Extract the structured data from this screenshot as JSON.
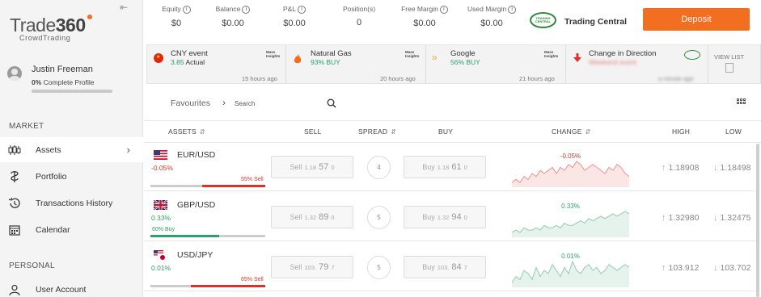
{
  "sidebar": {
    "logo_main": "Trade",
    "logo_num": "360",
    "logo_sub": "CrowdTrading",
    "collapse_icon": "collapse-left-icon",
    "user_name": "Justin Freeman",
    "profile_pct": "0%",
    "profile_text": "Complete Profile",
    "sections": {
      "market": "MARKET",
      "personal": "PERSONAL"
    },
    "items": [
      {
        "label": "Assets",
        "icon": "candlestick-icon"
      },
      {
        "label": "Portfolio",
        "icon": "portfolio-icon"
      },
      {
        "label": "Transactions History",
        "icon": "history-icon"
      },
      {
        "label": "Calendar",
        "icon": "calendar-icon"
      },
      {
        "label": "User Account",
        "icon": "user-icon"
      }
    ]
  },
  "stats": [
    {
      "label": "Equity",
      "value": "$0"
    },
    {
      "label": "Balance",
      "value": "$0.00"
    },
    {
      "label": "P&L",
      "value": "$0.00"
    },
    {
      "label": "Position(s)",
      "value": "0"
    },
    {
      "label": "Free Margin",
      "value": "$0.00"
    },
    {
      "label": "Used Margin",
      "value": "$0.00"
    }
  ],
  "trading_central": "Trading Central",
  "tc_logo_text": "TRADING CENTRAL",
  "deposit_label": "Deposit",
  "news": [
    {
      "title": "CNY event",
      "sub_num": "3.85",
      "sub_text": "Actual",
      "time": "15 hours ago",
      "badge": "Mass Insights"
    },
    {
      "title": "Natural Gas",
      "sub": "93% BUY",
      "time": "20 hours ago",
      "badge": "Mass Insights"
    },
    {
      "title": "Google",
      "sub": "56% BUY",
      "time": "21 hours ago",
      "badge": "Mass Insights"
    },
    {
      "title": "Change in Direction",
      "sub": "Weekend event",
      "time": "a minute ago"
    }
  ],
  "view_list": "VIEW LIST",
  "favourites_label": "Favourites",
  "search_placeholder": "Search",
  "columns": {
    "assets": "ASSETS",
    "sell": "SELL",
    "spread": "SPREAD",
    "buy": "BUY",
    "change": "CHANGE",
    "high": "HIGH",
    "low": "LOW"
  },
  "assets": [
    {
      "name": "EUR/USD",
      "change": "-0.05%",
      "sentiment": "55% Sell",
      "sentiment_side": "sell",
      "sentiment_pct": 55,
      "sell_label": "Sell",
      "sell_small": "1.18",
      "sell_big": "57",
      "sell_tail": "0",
      "spread": "4",
      "buy_label": "Buy",
      "buy_small": "1.18",
      "buy_big": "61",
      "buy_tail": "0",
      "spark_label": "-0.05%",
      "trend": "neg",
      "high": "1.18908",
      "low": "1.18498",
      "spark": [
        3,
        4,
        3,
        5,
        4,
        6,
        5,
        7,
        6,
        7,
        8,
        6,
        8,
        7,
        9,
        8,
        10,
        9,
        7,
        8,
        9,
        8,
        7,
        6,
        8,
        7,
        9,
        8,
        6,
        5
      ]
    },
    {
      "name": "GBP/USD",
      "change": "0.33%",
      "sentiment": "60% Buy",
      "sentiment_side": "buy",
      "sentiment_pct": 60,
      "sell_label": "Sell",
      "sell_small": "1.32",
      "sell_big": "89",
      "sell_tail": "0",
      "spread": "5",
      "buy_label": "Buy",
      "buy_small": "1.32",
      "buy_big": "94",
      "buy_tail": "0",
      "spark_label": "0.33%",
      "trend": "pos",
      "high": "1.32980",
      "low": "1.32475",
      "spark": [
        2,
        3,
        2,
        4,
        3,
        3,
        4,
        3,
        5,
        4,
        4,
        5,
        4,
        6,
        5,
        5,
        6,
        7,
        6,
        8,
        7,
        8,
        9,
        8,
        9,
        10,
        9,
        10,
        11,
        10
      ]
    },
    {
      "name": "USD/JPY",
      "change": "0.01%",
      "sentiment": "65% Sell",
      "sentiment_side": "sell",
      "sentiment_pct": 65,
      "sell_label": "Sell",
      "sell_small": "103.",
      "sell_big": "79",
      "sell_tail": "7",
      "spread": "5",
      "buy_label": "Buy",
      "buy_small": "103.",
      "buy_big": "84",
      "buy_tail": "7",
      "spark_label": "0.01%",
      "trend": "pos",
      "high": "103.912",
      "low": "103.702",
      "spark": [
        5,
        7,
        6,
        9,
        8,
        6,
        10,
        7,
        9,
        8,
        11,
        9,
        7,
        10,
        8,
        12,
        9,
        8,
        10,
        11,
        9,
        10,
        8,
        9,
        11,
        10,
        9,
        10,
        11,
        10
      ]
    }
  ],
  "colors": {
    "accent": "#f26f21",
    "positive": "#2ea06a",
    "negative": "#d9342b"
  }
}
